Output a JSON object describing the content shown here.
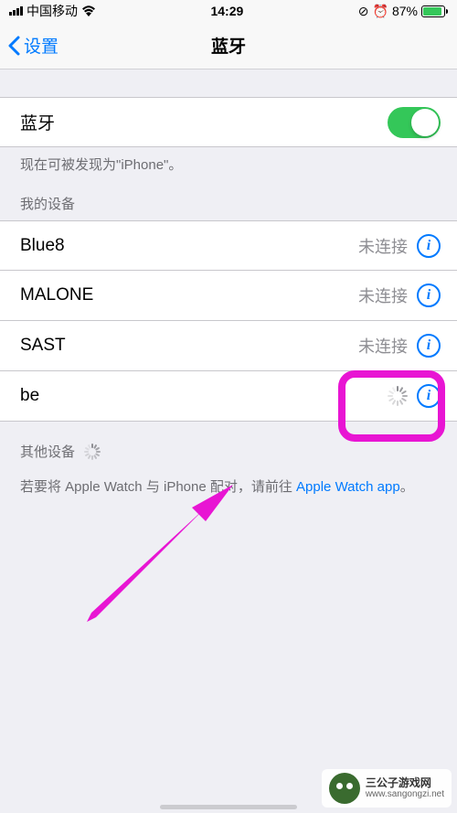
{
  "status": {
    "carrier": "中国移动",
    "time": "14:29",
    "battery_pct": "87%"
  },
  "nav": {
    "back_label": "设置",
    "title": "蓝牙"
  },
  "bluetooth_toggle": {
    "label": "蓝牙",
    "on": true
  },
  "discoverable_text": "现在可被发现为\"iPhone\"。",
  "my_devices_header": "我的设备",
  "devices": [
    {
      "name": "Blue8",
      "status": "未连接",
      "has_info": true,
      "loading": false
    },
    {
      "name": "MALONE",
      "status": "未连接",
      "has_info": true,
      "loading": false
    },
    {
      "name": "SAST",
      "status": "未连接",
      "has_info": true,
      "loading": false
    },
    {
      "name": "be",
      "status": "",
      "has_info": true,
      "loading": true
    }
  ],
  "other_devices_header": "其他设备",
  "apple_watch_text_1": "若要将 Apple Watch 与 iPhone 配对，请前往 ",
  "apple_watch_link": "Apple Watch app",
  "apple_watch_text_2": "。",
  "watermark": {
    "line1": "三公子游戏网",
    "line2": "www.sangongzi.net"
  }
}
